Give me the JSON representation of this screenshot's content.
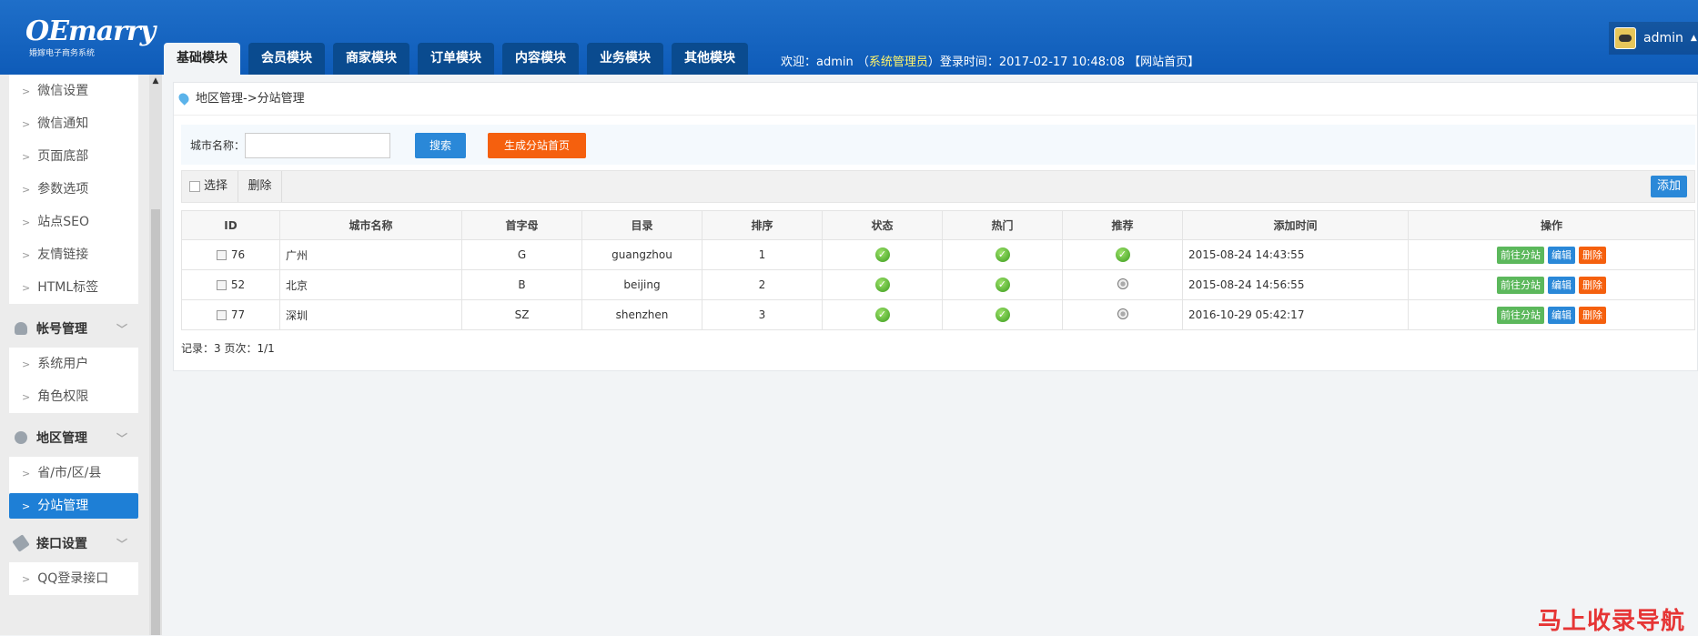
{
  "header": {
    "brand": "OEmarry",
    "brand_sub": "婚嫁电子商务系统",
    "tabs": [
      "基础模块",
      "会员模块",
      "商家模块",
      "订单模块",
      "内容模块",
      "业务模块",
      "其他模块"
    ],
    "welcome_prefix": "欢迎：admin （",
    "role": "系统管理员",
    "welcome_suffix": "）登录时间：2017-02-17 10:48:08 【网站首页】",
    "user": "admin"
  },
  "sidebar": {
    "items_top": [
      "微信设置",
      "微信通知",
      "页面底部",
      "参数选项",
      "站点SEO",
      "友情链接",
      "HTML标签"
    ],
    "group_account": "帐号管理",
    "items_account": [
      "系统用户",
      "角色权限"
    ],
    "group_region": "地区管理",
    "items_region": [
      "省/市/区/县",
      "分站管理"
    ],
    "group_api": "接口设置",
    "items_api": [
      "QQ登录接口"
    ]
  },
  "main": {
    "breadcrumb": "地区管理->分站管理",
    "search_label": "城市名称：",
    "search_value": "",
    "search_button": "搜索",
    "generate_button": "生成分站首页",
    "select_label": "选择",
    "delete_label": "删除",
    "add_button": "添加",
    "columns": [
      "ID",
      "城市名称",
      "首字母",
      "目录",
      "排序",
      "状态",
      "热门",
      "推荐",
      "添加时间",
      "操作"
    ],
    "rows": [
      {
        "id": "76",
        "city": "广州",
        "initial": "G",
        "dir": "guangzhou",
        "sort": "1",
        "status": true,
        "hot": true,
        "recommend": true,
        "time": "2015-08-24 14:43:55"
      },
      {
        "id": "52",
        "city": "北京",
        "initial": "B",
        "dir": "beijing",
        "sort": "2",
        "status": true,
        "hot": true,
        "recommend": false,
        "time": "2015-08-24 14:56:55"
      },
      {
        "id": "77",
        "city": "深圳",
        "initial": "SZ",
        "dir": "shenzhen",
        "sort": "3",
        "status": true,
        "hot": true,
        "recommend": false,
        "time": "2016-10-29 05:42:17"
      }
    ],
    "action_go": "前往分站",
    "action_edit": "编辑",
    "action_delete": "删除",
    "footer": "记录：3  页次：1/1"
  },
  "watermark": "马上收录导航",
  "colors": {
    "header_bg": "#1264c0",
    "primary": "#2a88d8",
    "orange": "#f5600e",
    "green": "#5cb85c",
    "role_text": "#fff46a"
  }
}
